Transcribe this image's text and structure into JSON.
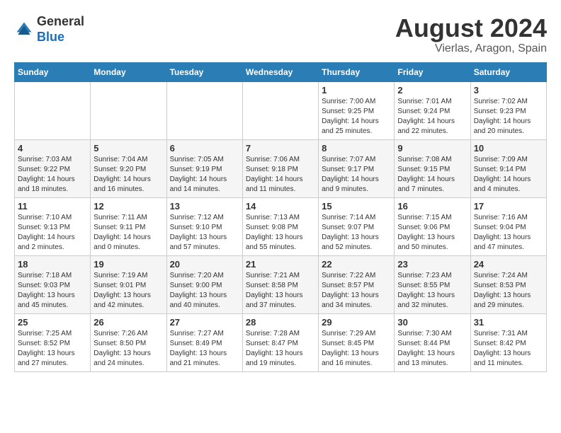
{
  "header": {
    "logo_general": "General",
    "logo_blue": "Blue",
    "title": "August 2024",
    "subtitle": "Vierlas, Aragon, Spain"
  },
  "days_of_week": [
    "Sunday",
    "Monday",
    "Tuesday",
    "Wednesday",
    "Thursday",
    "Friday",
    "Saturday"
  ],
  "weeks": [
    [
      {
        "day": "",
        "info": ""
      },
      {
        "day": "",
        "info": ""
      },
      {
        "day": "",
        "info": ""
      },
      {
        "day": "",
        "info": ""
      },
      {
        "day": "1",
        "info": "Sunrise: 7:00 AM\nSunset: 9:25 PM\nDaylight: 14 hours\nand 25 minutes."
      },
      {
        "day": "2",
        "info": "Sunrise: 7:01 AM\nSunset: 9:24 PM\nDaylight: 14 hours\nand 22 minutes."
      },
      {
        "day": "3",
        "info": "Sunrise: 7:02 AM\nSunset: 9:23 PM\nDaylight: 14 hours\nand 20 minutes."
      }
    ],
    [
      {
        "day": "4",
        "info": "Sunrise: 7:03 AM\nSunset: 9:22 PM\nDaylight: 14 hours\nand 18 minutes."
      },
      {
        "day": "5",
        "info": "Sunrise: 7:04 AM\nSunset: 9:20 PM\nDaylight: 14 hours\nand 16 minutes."
      },
      {
        "day": "6",
        "info": "Sunrise: 7:05 AM\nSunset: 9:19 PM\nDaylight: 14 hours\nand 14 minutes."
      },
      {
        "day": "7",
        "info": "Sunrise: 7:06 AM\nSunset: 9:18 PM\nDaylight: 14 hours\nand 11 minutes."
      },
      {
        "day": "8",
        "info": "Sunrise: 7:07 AM\nSunset: 9:17 PM\nDaylight: 14 hours\nand 9 minutes."
      },
      {
        "day": "9",
        "info": "Sunrise: 7:08 AM\nSunset: 9:15 PM\nDaylight: 14 hours\nand 7 minutes."
      },
      {
        "day": "10",
        "info": "Sunrise: 7:09 AM\nSunset: 9:14 PM\nDaylight: 14 hours\nand 4 minutes."
      }
    ],
    [
      {
        "day": "11",
        "info": "Sunrise: 7:10 AM\nSunset: 9:13 PM\nDaylight: 14 hours\nand 2 minutes."
      },
      {
        "day": "12",
        "info": "Sunrise: 7:11 AM\nSunset: 9:11 PM\nDaylight: 14 hours\nand 0 minutes."
      },
      {
        "day": "13",
        "info": "Sunrise: 7:12 AM\nSunset: 9:10 PM\nDaylight: 13 hours\nand 57 minutes."
      },
      {
        "day": "14",
        "info": "Sunrise: 7:13 AM\nSunset: 9:08 PM\nDaylight: 13 hours\nand 55 minutes."
      },
      {
        "day": "15",
        "info": "Sunrise: 7:14 AM\nSunset: 9:07 PM\nDaylight: 13 hours\nand 52 minutes."
      },
      {
        "day": "16",
        "info": "Sunrise: 7:15 AM\nSunset: 9:06 PM\nDaylight: 13 hours\nand 50 minutes."
      },
      {
        "day": "17",
        "info": "Sunrise: 7:16 AM\nSunset: 9:04 PM\nDaylight: 13 hours\nand 47 minutes."
      }
    ],
    [
      {
        "day": "18",
        "info": "Sunrise: 7:18 AM\nSunset: 9:03 PM\nDaylight: 13 hours\nand 45 minutes."
      },
      {
        "day": "19",
        "info": "Sunrise: 7:19 AM\nSunset: 9:01 PM\nDaylight: 13 hours\nand 42 minutes."
      },
      {
        "day": "20",
        "info": "Sunrise: 7:20 AM\nSunset: 9:00 PM\nDaylight: 13 hours\nand 40 minutes."
      },
      {
        "day": "21",
        "info": "Sunrise: 7:21 AM\nSunset: 8:58 PM\nDaylight: 13 hours\nand 37 minutes."
      },
      {
        "day": "22",
        "info": "Sunrise: 7:22 AM\nSunset: 8:57 PM\nDaylight: 13 hours\nand 34 minutes."
      },
      {
        "day": "23",
        "info": "Sunrise: 7:23 AM\nSunset: 8:55 PM\nDaylight: 13 hours\nand 32 minutes."
      },
      {
        "day": "24",
        "info": "Sunrise: 7:24 AM\nSunset: 8:53 PM\nDaylight: 13 hours\nand 29 minutes."
      }
    ],
    [
      {
        "day": "25",
        "info": "Sunrise: 7:25 AM\nSunset: 8:52 PM\nDaylight: 13 hours\nand 27 minutes."
      },
      {
        "day": "26",
        "info": "Sunrise: 7:26 AM\nSunset: 8:50 PM\nDaylight: 13 hours\nand 24 minutes."
      },
      {
        "day": "27",
        "info": "Sunrise: 7:27 AM\nSunset: 8:49 PM\nDaylight: 13 hours\nand 21 minutes."
      },
      {
        "day": "28",
        "info": "Sunrise: 7:28 AM\nSunset: 8:47 PM\nDaylight: 13 hours\nand 19 minutes."
      },
      {
        "day": "29",
        "info": "Sunrise: 7:29 AM\nSunset: 8:45 PM\nDaylight: 13 hours\nand 16 minutes."
      },
      {
        "day": "30",
        "info": "Sunrise: 7:30 AM\nSunset: 8:44 PM\nDaylight: 13 hours\nand 13 minutes."
      },
      {
        "day": "31",
        "info": "Sunrise: 7:31 AM\nSunset: 8:42 PM\nDaylight: 13 hours\nand 11 minutes."
      }
    ]
  ]
}
